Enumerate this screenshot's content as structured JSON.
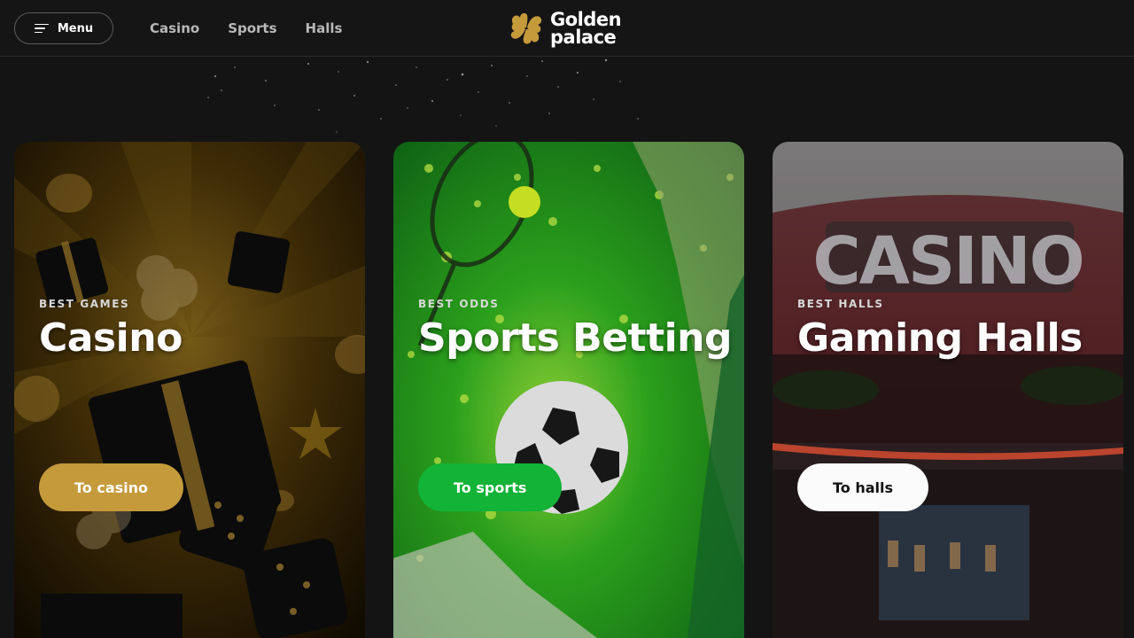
{
  "header": {
    "menu_label": "Menu",
    "nav": [
      "Casino",
      "Sports",
      "Halls"
    ],
    "logo_line1": "Golden",
    "logo_line2": "palace"
  },
  "colors": {
    "page_bg": "#141414",
    "gold": "#c59a3b",
    "green": "#12b337",
    "white": "#fbfbfb"
  },
  "cards": [
    {
      "eyebrow": "BEST GAMES",
      "title": "Casino",
      "button": "To casino"
    },
    {
      "eyebrow": "BEST ODDS",
      "title": "Sports Betting",
      "button": "To sports"
    },
    {
      "eyebrow": "BEST HALLS",
      "title": "Gaming Halls",
      "button": "To halls"
    }
  ]
}
